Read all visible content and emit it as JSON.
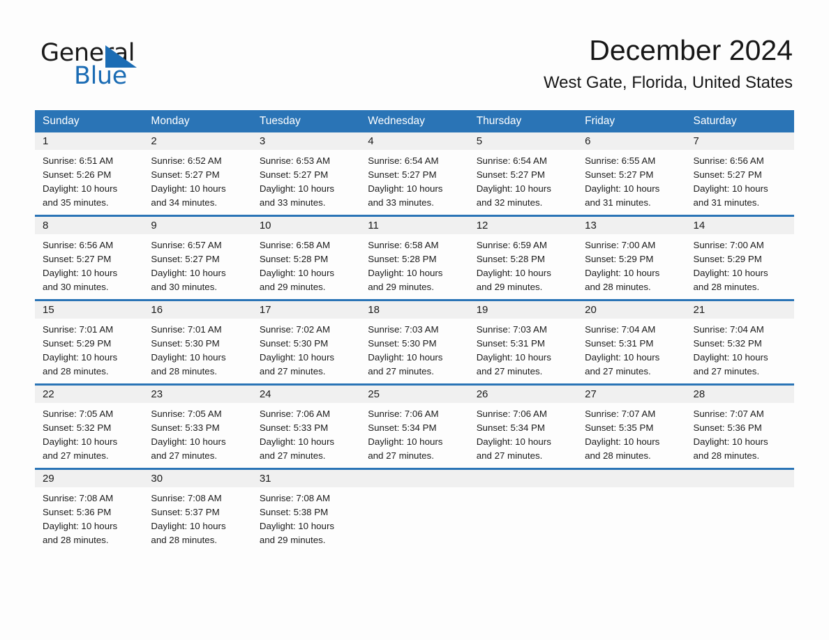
{
  "brand": {
    "logo_text_top": "General",
    "logo_text_bottom": "Blue",
    "accent_color": "#1b6cb4"
  },
  "header": {
    "month_title": "December 2024",
    "location": "West Gate, Florida, United States"
  },
  "calendar": {
    "header_bg_color": "#2a74b6",
    "day_band_color": "#f0f0f0",
    "weekdays": [
      "Sunday",
      "Monday",
      "Tuesday",
      "Wednesday",
      "Thursday",
      "Friday",
      "Saturday"
    ],
    "weeks": [
      [
        {
          "day": "1",
          "sunrise": "Sunrise: 6:51 AM",
          "sunset": "Sunset: 5:26 PM",
          "daylight_line1": "Daylight: 10 hours",
          "daylight_line2": "and 35 minutes."
        },
        {
          "day": "2",
          "sunrise": "Sunrise: 6:52 AM",
          "sunset": "Sunset: 5:27 PM",
          "daylight_line1": "Daylight: 10 hours",
          "daylight_line2": "and 34 minutes."
        },
        {
          "day": "3",
          "sunrise": "Sunrise: 6:53 AM",
          "sunset": "Sunset: 5:27 PM",
          "daylight_line1": "Daylight: 10 hours",
          "daylight_line2": "and 33 minutes."
        },
        {
          "day": "4",
          "sunrise": "Sunrise: 6:54 AM",
          "sunset": "Sunset: 5:27 PM",
          "daylight_line1": "Daylight: 10 hours",
          "daylight_line2": "and 33 minutes."
        },
        {
          "day": "5",
          "sunrise": "Sunrise: 6:54 AM",
          "sunset": "Sunset: 5:27 PM",
          "daylight_line1": "Daylight: 10 hours",
          "daylight_line2": "and 32 minutes."
        },
        {
          "day": "6",
          "sunrise": "Sunrise: 6:55 AM",
          "sunset": "Sunset: 5:27 PM",
          "daylight_line1": "Daylight: 10 hours",
          "daylight_line2": "and 31 minutes."
        },
        {
          "day": "7",
          "sunrise": "Sunrise: 6:56 AM",
          "sunset": "Sunset: 5:27 PM",
          "daylight_line1": "Daylight: 10 hours",
          "daylight_line2": "and 31 minutes."
        }
      ],
      [
        {
          "day": "8",
          "sunrise": "Sunrise: 6:56 AM",
          "sunset": "Sunset: 5:27 PM",
          "daylight_line1": "Daylight: 10 hours",
          "daylight_line2": "and 30 minutes."
        },
        {
          "day": "9",
          "sunrise": "Sunrise: 6:57 AM",
          "sunset": "Sunset: 5:27 PM",
          "daylight_line1": "Daylight: 10 hours",
          "daylight_line2": "and 30 minutes."
        },
        {
          "day": "10",
          "sunrise": "Sunrise: 6:58 AM",
          "sunset": "Sunset: 5:28 PM",
          "daylight_line1": "Daylight: 10 hours",
          "daylight_line2": "and 29 minutes."
        },
        {
          "day": "11",
          "sunrise": "Sunrise: 6:58 AM",
          "sunset": "Sunset: 5:28 PM",
          "daylight_line1": "Daylight: 10 hours",
          "daylight_line2": "and 29 minutes."
        },
        {
          "day": "12",
          "sunrise": "Sunrise: 6:59 AM",
          "sunset": "Sunset: 5:28 PM",
          "daylight_line1": "Daylight: 10 hours",
          "daylight_line2": "and 29 minutes."
        },
        {
          "day": "13",
          "sunrise": "Sunrise: 7:00 AM",
          "sunset": "Sunset: 5:29 PM",
          "daylight_line1": "Daylight: 10 hours",
          "daylight_line2": "and 28 minutes."
        },
        {
          "day": "14",
          "sunrise": "Sunrise: 7:00 AM",
          "sunset": "Sunset: 5:29 PM",
          "daylight_line1": "Daylight: 10 hours",
          "daylight_line2": "and 28 minutes."
        }
      ],
      [
        {
          "day": "15",
          "sunrise": "Sunrise: 7:01 AM",
          "sunset": "Sunset: 5:29 PM",
          "daylight_line1": "Daylight: 10 hours",
          "daylight_line2": "and 28 minutes."
        },
        {
          "day": "16",
          "sunrise": "Sunrise: 7:01 AM",
          "sunset": "Sunset: 5:30 PM",
          "daylight_line1": "Daylight: 10 hours",
          "daylight_line2": "and 28 minutes."
        },
        {
          "day": "17",
          "sunrise": "Sunrise: 7:02 AM",
          "sunset": "Sunset: 5:30 PM",
          "daylight_line1": "Daylight: 10 hours",
          "daylight_line2": "and 27 minutes."
        },
        {
          "day": "18",
          "sunrise": "Sunrise: 7:03 AM",
          "sunset": "Sunset: 5:30 PM",
          "daylight_line1": "Daylight: 10 hours",
          "daylight_line2": "and 27 minutes."
        },
        {
          "day": "19",
          "sunrise": "Sunrise: 7:03 AM",
          "sunset": "Sunset: 5:31 PM",
          "daylight_line1": "Daylight: 10 hours",
          "daylight_line2": "and 27 minutes."
        },
        {
          "day": "20",
          "sunrise": "Sunrise: 7:04 AM",
          "sunset": "Sunset: 5:31 PM",
          "daylight_line1": "Daylight: 10 hours",
          "daylight_line2": "and 27 minutes."
        },
        {
          "day": "21",
          "sunrise": "Sunrise: 7:04 AM",
          "sunset": "Sunset: 5:32 PM",
          "daylight_line1": "Daylight: 10 hours",
          "daylight_line2": "and 27 minutes."
        }
      ],
      [
        {
          "day": "22",
          "sunrise": "Sunrise: 7:05 AM",
          "sunset": "Sunset: 5:32 PM",
          "daylight_line1": "Daylight: 10 hours",
          "daylight_line2": "and 27 minutes."
        },
        {
          "day": "23",
          "sunrise": "Sunrise: 7:05 AM",
          "sunset": "Sunset: 5:33 PM",
          "daylight_line1": "Daylight: 10 hours",
          "daylight_line2": "and 27 minutes."
        },
        {
          "day": "24",
          "sunrise": "Sunrise: 7:06 AM",
          "sunset": "Sunset: 5:33 PM",
          "daylight_line1": "Daylight: 10 hours",
          "daylight_line2": "and 27 minutes."
        },
        {
          "day": "25",
          "sunrise": "Sunrise: 7:06 AM",
          "sunset": "Sunset: 5:34 PM",
          "daylight_line1": "Daylight: 10 hours",
          "daylight_line2": "and 27 minutes."
        },
        {
          "day": "26",
          "sunrise": "Sunrise: 7:06 AM",
          "sunset": "Sunset: 5:34 PM",
          "daylight_line1": "Daylight: 10 hours",
          "daylight_line2": "and 27 minutes."
        },
        {
          "day": "27",
          "sunrise": "Sunrise: 7:07 AM",
          "sunset": "Sunset: 5:35 PM",
          "daylight_line1": "Daylight: 10 hours",
          "daylight_line2": "and 28 minutes."
        },
        {
          "day": "28",
          "sunrise": "Sunrise: 7:07 AM",
          "sunset": "Sunset: 5:36 PM",
          "daylight_line1": "Daylight: 10 hours",
          "daylight_line2": "and 28 minutes."
        }
      ],
      [
        {
          "day": "29",
          "sunrise": "Sunrise: 7:08 AM",
          "sunset": "Sunset: 5:36 PM",
          "daylight_line1": "Daylight: 10 hours",
          "daylight_line2": "and 28 minutes."
        },
        {
          "day": "30",
          "sunrise": "Sunrise: 7:08 AM",
          "sunset": "Sunset: 5:37 PM",
          "daylight_line1": "Daylight: 10 hours",
          "daylight_line2": "and 28 minutes."
        },
        {
          "day": "31",
          "sunrise": "Sunrise: 7:08 AM",
          "sunset": "Sunset: 5:38 PM",
          "daylight_line1": "Daylight: 10 hours",
          "daylight_line2": "and 29 minutes."
        },
        {
          "day": "",
          "sunrise": "",
          "sunset": "",
          "daylight_line1": "",
          "daylight_line2": ""
        },
        {
          "day": "",
          "sunrise": "",
          "sunset": "",
          "daylight_line1": "",
          "daylight_line2": ""
        },
        {
          "day": "",
          "sunrise": "",
          "sunset": "",
          "daylight_line1": "",
          "daylight_line2": ""
        },
        {
          "day": "",
          "sunrise": "",
          "sunset": "",
          "daylight_line1": "",
          "daylight_line2": ""
        }
      ]
    ]
  }
}
